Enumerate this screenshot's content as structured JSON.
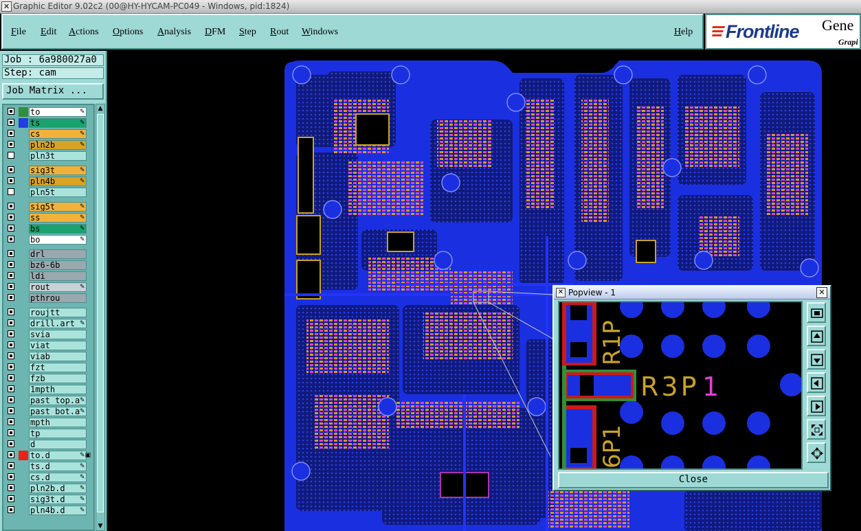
{
  "window": {
    "title": "Graphic Editor 9.02c2 (00@HY-HYCAM-PC049 - Windows, pid:1824)"
  },
  "menu": {
    "items": [
      "File",
      "Edit",
      "Actions",
      "Options",
      "Analysis",
      "DFM",
      "Step",
      "Rout",
      "Windows"
    ],
    "help": "Help"
  },
  "logo": {
    "brand": "Frontline",
    "product": "Gene",
    "subtitle": "Grapi"
  },
  "job": {
    "label": "Job : 6a980027a0",
    "step": "Step: cam",
    "matrix_button": "Job Matrix ..."
  },
  "layers": [
    {
      "name": "to",
      "checked": true,
      "swatch": "#2f8f3a",
      "bg": "#ffffff",
      "flag": "✎"
    },
    {
      "name": "ts",
      "checked": true,
      "swatch": "#1f3fe0",
      "bg": "#1aa36e",
      "flag": "✎"
    },
    {
      "name": "cs",
      "checked": true,
      "swatch": "",
      "bg": "#f2b23a",
      "flag": "✎"
    },
    {
      "name": "pln2b",
      "checked": true,
      "swatch": "",
      "bg": "#d9a326",
      "flag": "✎"
    },
    {
      "name": "pln3t",
      "checked": false,
      "swatch": "",
      "bg": "#a9e3dc",
      "flag": ""
    },
    {
      "name": "sig3t",
      "checked": true,
      "swatch": "",
      "bg": "#f2b23a",
      "flag": "✎"
    },
    {
      "name": "pln4b",
      "checked": true,
      "swatch": "",
      "bg": "#d9a326",
      "flag": "✎"
    },
    {
      "name": "pln5t",
      "checked": false,
      "swatch": "",
      "bg": "#a9e3dc",
      "flag": ""
    },
    {
      "name": "sig5t",
      "checked": true,
      "swatch": "",
      "bg": "#f2b23a",
      "flag": "✎"
    },
    {
      "name": "ss",
      "checked": true,
      "swatch": "",
      "bg": "#f2b23a",
      "flag": "✎"
    },
    {
      "name": "bs",
      "checked": true,
      "swatch": "",
      "bg": "#1aa36e",
      "flag": "✎"
    },
    {
      "name": "bo",
      "checked": true,
      "swatch": "",
      "bg": "#ffffff",
      "flag": "✎"
    },
    {
      "name": "drl",
      "checked": true,
      "swatch": "",
      "bg": "#9aa8b0",
      "flag": ""
    },
    {
      "name": "bz6-6b",
      "checked": true,
      "swatch": "",
      "bg": "#9aa8b0",
      "flag": ""
    },
    {
      "name": "ldi",
      "checked": true,
      "swatch": "",
      "bg": "#9aa8b0",
      "flag": ""
    },
    {
      "name": "rout",
      "checked": true,
      "swatch": "",
      "bg": "#c8d2d6",
      "flag": "✎"
    },
    {
      "name": "pthrou",
      "checked": true,
      "swatch": "",
      "bg": "#9aa8b0",
      "flag": ""
    },
    {
      "name": "roujtt",
      "checked": true,
      "swatch": "",
      "bg": "#a9e3dc",
      "flag": ""
    },
    {
      "name": "drill.art",
      "checked": true,
      "swatch": "",
      "bg": "#a9e3dc",
      "flag": "✎"
    },
    {
      "name": "svia",
      "checked": true,
      "swatch": "",
      "bg": "#a9e3dc",
      "flag": ""
    },
    {
      "name": "viat",
      "checked": true,
      "swatch": "",
      "bg": "#a9e3dc",
      "flag": ""
    },
    {
      "name": "viab",
      "checked": true,
      "swatch": "",
      "bg": "#a9e3dc",
      "flag": ""
    },
    {
      "name": "fzt",
      "checked": true,
      "swatch": "",
      "bg": "#a9e3dc",
      "flag": ""
    },
    {
      "name": "fzb",
      "checked": true,
      "swatch": "",
      "bg": "#a9e3dc",
      "flag": ""
    },
    {
      "name": "1mpth",
      "checked": true,
      "swatch": "",
      "bg": "#a9e3dc",
      "flag": ""
    },
    {
      "name": "past_top.a",
      "checked": true,
      "swatch": "",
      "bg": "#a9e3dc",
      "flag": "✎"
    },
    {
      "name": "past_bot.a",
      "checked": true,
      "swatch": "",
      "bg": "#a9e3dc",
      "flag": "✎"
    },
    {
      "name": "mpth",
      "checked": true,
      "swatch": "",
      "bg": "#a9e3dc",
      "flag": ""
    },
    {
      "name": "tp",
      "checked": true,
      "swatch": "",
      "bg": "#a9e3dc",
      "flag": ""
    },
    {
      "name": "d",
      "checked": true,
      "swatch": "",
      "bg": "#a9e3dc",
      "flag": ""
    },
    {
      "name": "to.d",
      "checked": true,
      "swatch": "#e8221b",
      "bg": "#a9e3dc",
      "flag": "✎▣"
    },
    {
      "name": "ts.d",
      "checked": true,
      "swatch": "",
      "bg": "#a9e3dc",
      "flag": "✎"
    },
    {
      "name": "cs.d",
      "checked": true,
      "swatch": "",
      "bg": "#a9e3dc",
      "flag": "✎"
    },
    {
      "name": "pln2b.d",
      "checked": true,
      "swatch": "",
      "bg": "#a9e3dc",
      "flag": "✎"
    },
    {
      "name": "sig3t.d",
      "checked": true,
      "swatch": "",
      "bg": "#a9e3dc",
      "flag": "✎"
    },
    {
      "name": "pln4b.d",
      "checked": true,
      "swatch": "",
      "bg": "#a9e3dc",
      "flag": "✎"
    }
  ],
  "popview": {
    "title": "Popview - 1",
    "close_label": "Close",
    "labels": {
      "r1p": "R1P",
      "r3p": "R3P",
      "one": "1",
      "c6p1": "6P1"
    }
  },
  "colors": {
    "panel": "#9fd9d5",
    "board_blue": "#1a2fe0",
    "copper_gold": "#c9a227",
    "pad_magenta": "#e040d0"
  }
}
